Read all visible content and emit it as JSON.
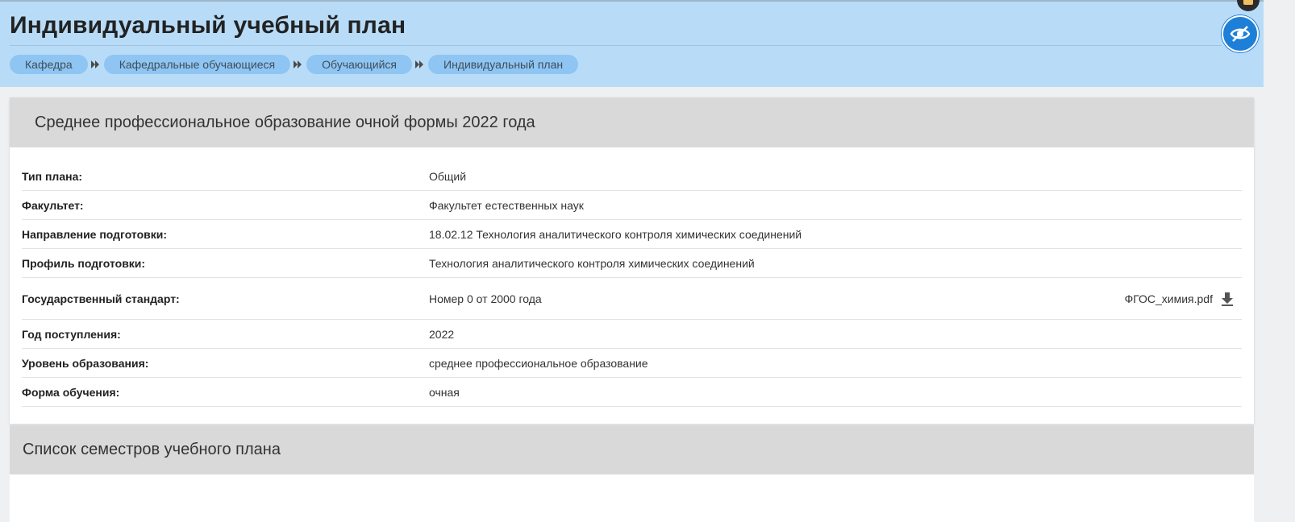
{
  "header": {
    "title": "Индивидуальный учебный план",
    "breadcrumbs": [
      "Кафедра",
      "Кафедральные обучающиеся",
      "Обучающийся",
      "Индивидуальный план"
    ]
  },
  "plan_card": {
    "title": "Среднее профессиональное образование очной формы 2022 года",
    "rows": [
      {
        "label": "Тип плана:",
        "value": "Общий"
      },
      {
        "label": "Факультет:",
        "value": "Факультет естественных наук"
      },
      {
        "label": "Направление подготовки:",
        "value": "18.02.12 Технология аналитического контроля химических соединений"
      },
      {
        "label": "Профиль подготовки:",
        "value": "Технология аналитического контроля химических соединений"
      },
      {
        "label": "Государственный стандарт:",
        "value": "Номер 0 от 2000 года",
        "file": "ФГОС_химия.pdf"
      },
      {
        "label": "Год поступления:",
        "value": "2022"
      },
      {
        "label": "Уровень образования:",
        "value": "среднее профессиональное образование"
      },
      {
        "label": "Форма обучения:",
        "value": "очная"
      }
    ]
  },
  "semesters_card": {
    "title": "Список семестров учебного плана"
  },
  "icons": {
    "breadcrumb_separator": "double-chevron-right-icon",
    "accessibility": "eye-slash-icon",
    "download": "download-icon",
    "chat": "chat-icon"
  },
  "colors": {
    "header_bg": "#b8dcf8",
    "crumb_bg": "#8ec5f2",
    "card_head_bg": "#d9d9d9",
    "accent": "#1e7fd8"
  }
}
